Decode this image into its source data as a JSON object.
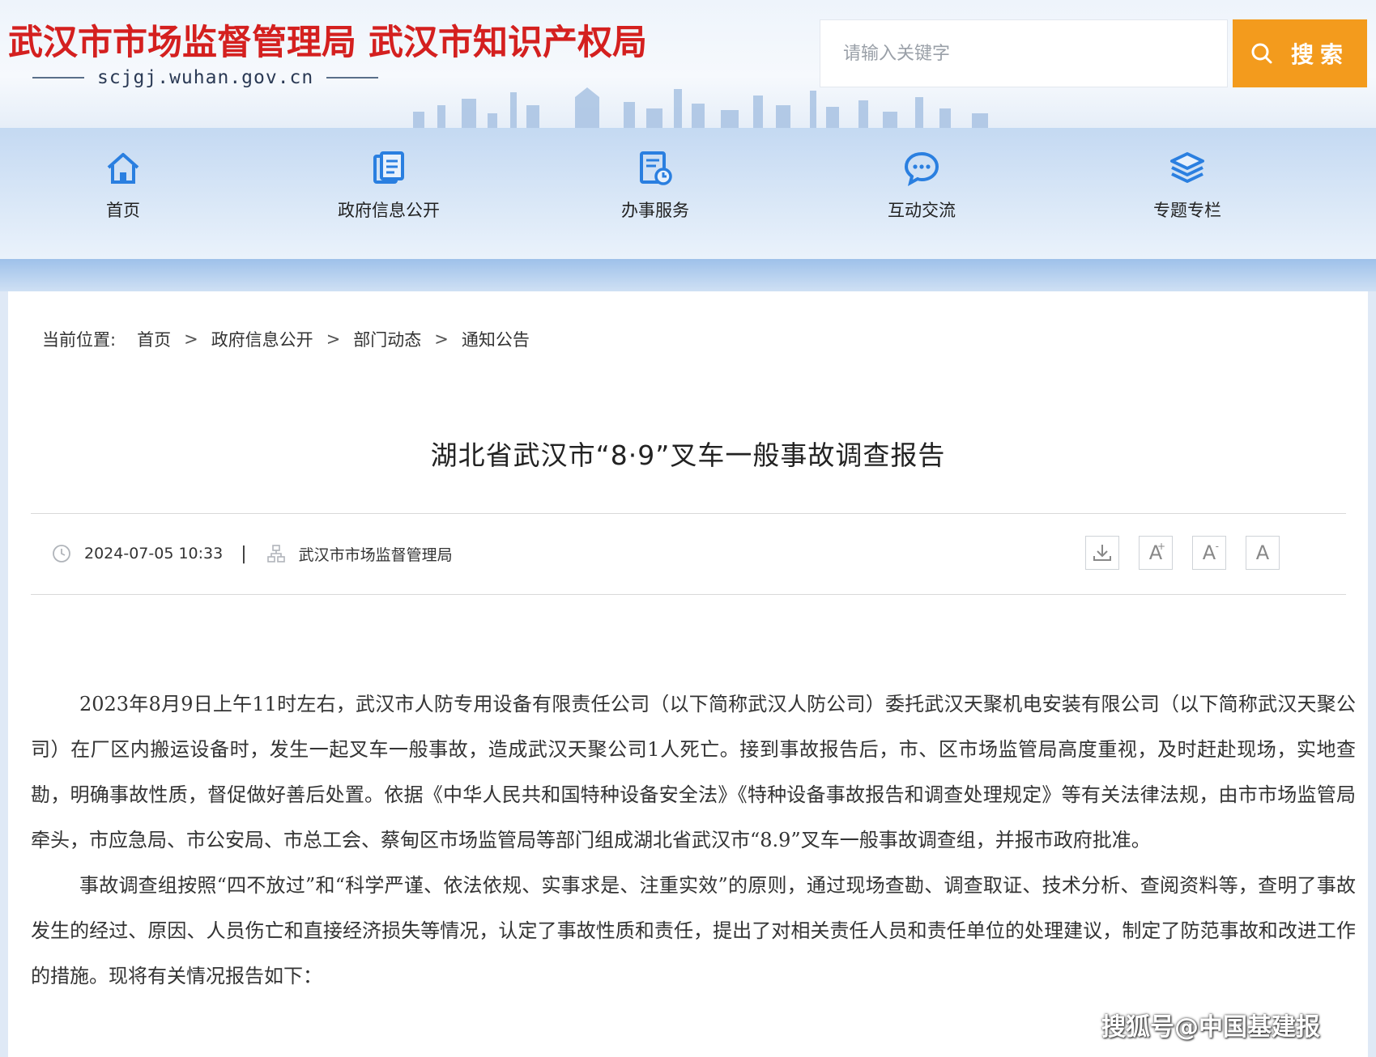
{
  "header": {
    "title_a": "武汉市市场监督管理局 武汉市知识产权局",
    "domain": "scjgj.wuhan.gov.cn",
    "search_placeholder": "请输入关键字",
    "search_label": "搜索"
  },
  "nav": [
    {
      "label": "首页",
      "icon": "home-icon"
    },
    {
      "label": "政府信息公开",
      "icon": "document-icon"
    },
    {
      "label": "办事服务",
      "icon": "service-icon"
    },
    {
      "label": "互动交流",
      "icon": "chat-icon"
    },
    {
      "label": "专题专栏",
      "icon": "layers-icon"
    }
  ],
  "breadcrumb": {
    "prefix": "当前位置:",
    "items": [
      "首页",
      "政府信息公开",
      "部门动态",
      "通知公告"
    ],
    "separator": ">"
  },
  "article": {
    "title": "湖北省武汉市“8·9”叉车一般事故调查报告",
    "date": "2024-07-05 10:33",
    "source": "武汉市市场监督管理局",
    "paragraphs": [
      "2023年8月9日上午11时左右，武汉市人防专用设备有限责任公司（以下简称武汉人防公司）委托武汉天聚机电安装有限公司（以下简称武汉天聚公司）在厂区内搬运设备时，发生一起叉车一般事故，造成武汉天聚公司1人死亡。接到事故报告后，市、区市场监管局高度重视，及时赶赴现场，实地查勘，明确事故性质，督促做好善后处置。依据《中华人民共和国特种设备安全法》《特种设备事故报告和调查处理规定》等有关法律法规，由市市场监管局牵头，市应急局、市公安局、市总工会、蔡甸区市场监管局等部门组成湖北省武汉市“8.9”叉车一般事故调查组，并报市政府批准。",
      "事故调查组按照“四不放过”和“科学严谨、依法依规、实事求是、注重实效”的原则，通过现场查勘、调查取证、技术分析、查阅资料等，查明了事故发生的经过、原因、人员伤亡和直接经济损失等情况，认定了事故性质和责任，提出了对相关责任人员和责任单位的处理建议，制定了防范事故和改进工作的措施。现将有关情况报告如下："
    ]
  },
  "tools": [
    {
      "name": "download-button",
      "icon": "download-icon"
    },
    {
      "name": "font-increase-button",
      "text": "A",
      "sup": "+"
    },
    {
      "name": "font-decrease-button",
      "text": "A",
      "sup": "-"
    },
    {
      "name": "font-reset-button",
      "text": "A"
    }
  ],
  "watermark": "搜狐号@中国基建报",
  "colors": {
    "title_red": "#d4201f",
    "search_orange": "#f39b1d",
    "nav_icon_blue": "#2a7fe0"
  }
}
